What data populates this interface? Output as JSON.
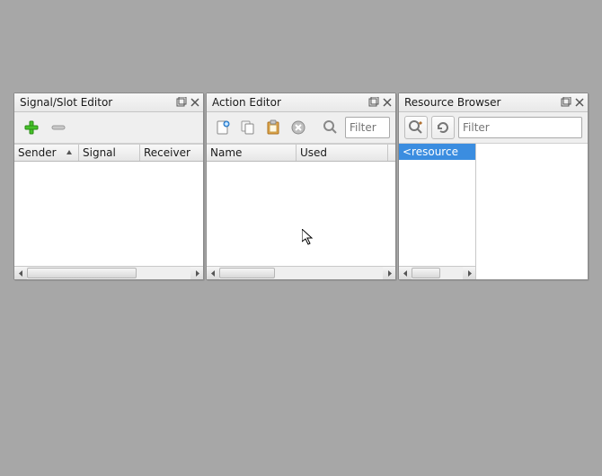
{
  "panels": {
    "signal": {
      "title": "Signal/Slot Editor",
      "columns": [
        "Sender",
        "Signal",
        "Receiver"
      ]
    },
    "action": {
      "title": "Action Editor",
      "filter_placeholder": "Filter",
      "columns": [
        "Name",
        "Used"
      ]
    },
    "resource": {
      "title": "Resource Browser",
      "filter_placeholder": "Filter",
      "left_item": "<resource"
    }
  }
}
